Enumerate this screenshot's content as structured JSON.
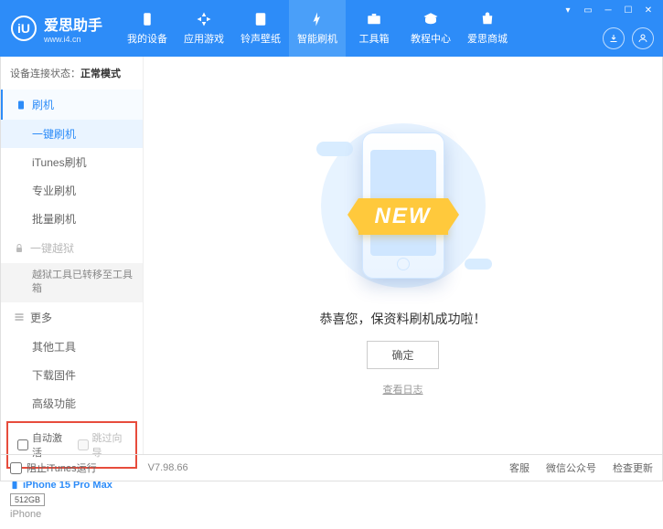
{
  "header": {
    "logo_letter": "iU",
    "title": "爱思助手",
    "subtitle": "www.i4.cn",
    "nav": [
      {
        "label": "我的设备"
      },
      {
        "label": "应用游戏"
      },
      {
        "label": "铃声壁纸"
      },
      {
        "label": "智能刷机"
      },
      {
        "label": "工具箱"
      },
      {
        "label": "教程中心"
      },
      {
        "label": "爱思商城"
      }
    ]
  },
  "sidebar": {
    "status_prefix": "设备连接状态：",
    "status_value": "正常模式",
    "sec_flash": "刷机",
    "items_flash": [
      "一键刷机",
      "iTunes刷机",
      "专业刷机",
      "批量刷机"
    ],
    "sec_jailbreak": "一键越狱",
    "jailbreak_note": "越狱工具已转移至工具箱",
    "sec_more": "更多",
    "items_more": [
      "其他工具",
      "下载固件",
      "高级功能"
    ],
    "cb_auto": "自动激活",
    "cb_skip": "跳过向导",
    "device_name": "iPhone 15 Pro Max",
    "device_storage": "512GB",
    "device_type": "iPhone"
  },
  "main": {
    "ribbon": "NEW",
    "success": "恭喜您，保资料刷机成功啦！",
    "ok": "确定",
    "loglink": "查看日志"
  },
  "footer": {
    "block_itunes": "阻止iTunes运行",
    "version": "V7.98.66",
    "links": [
      "客服",
      "微信公众号",
      "检查更新"
    ]
  }
}
